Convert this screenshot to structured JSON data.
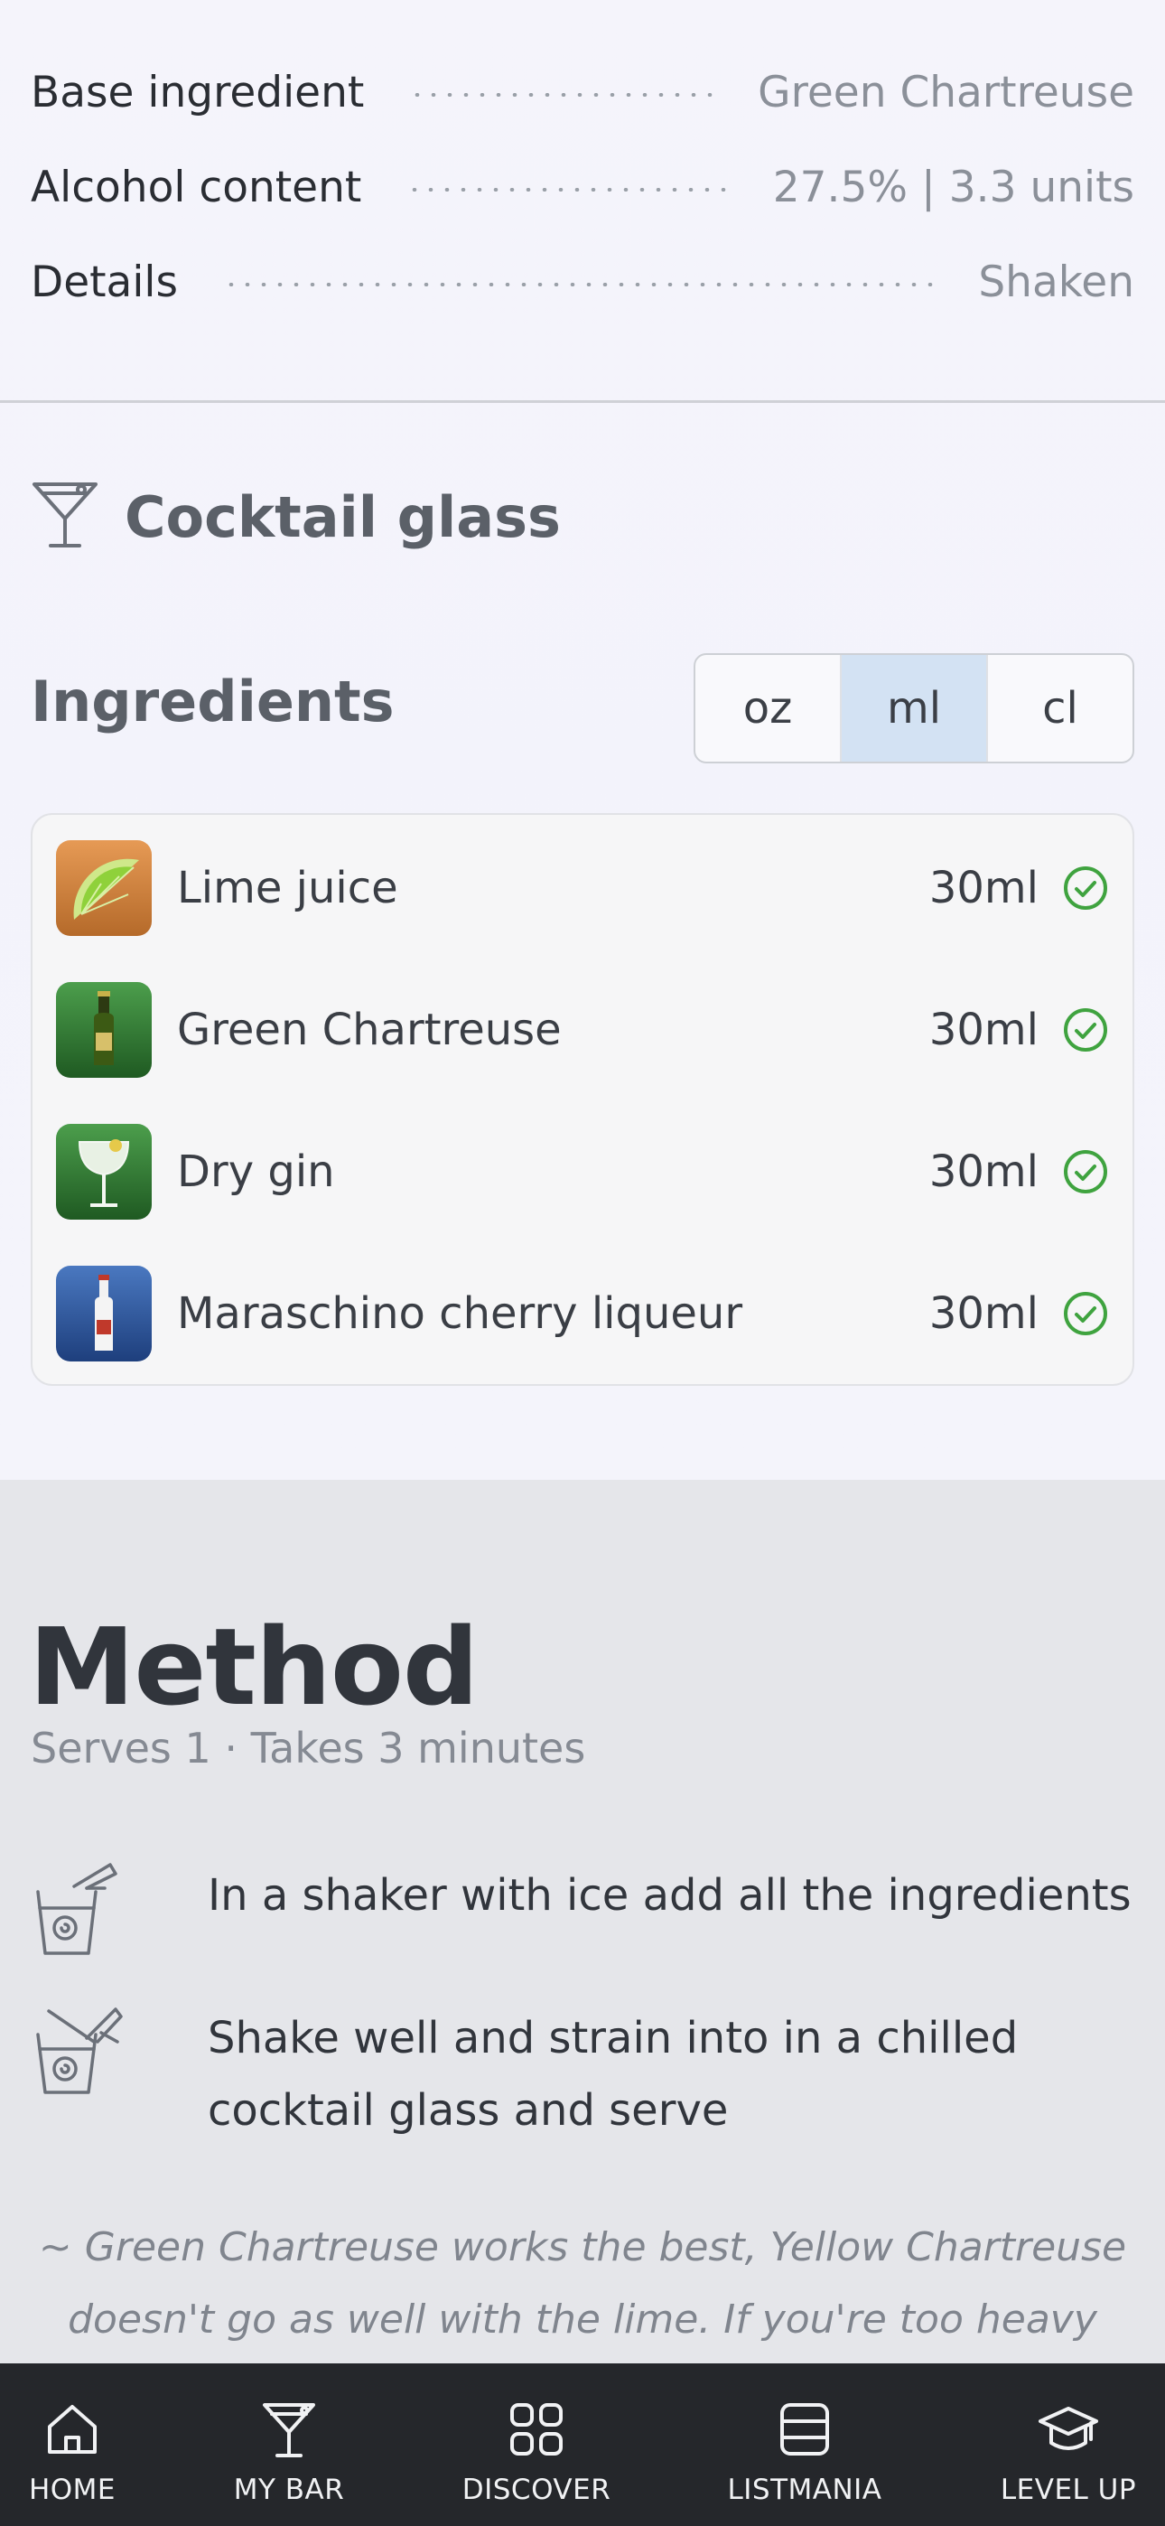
{
  "details": [
    {
      "label": "Base ingredient",
      "value": "Green Chartreuse"
    },
    {
      "label": "Alcohol content",
      "value": "27.5% | 3.3 units"
    },
    {
      "label": "Details",
      "value": "Shaken"
    }
  ],
  "glass": {
    "label": "Cocktail glass",
    "icon": "cocktail-glass-icon"
  },
  "ingredients": {
    "title": "Ingredients",
    "units": [
      {
        "label": "oz",
        "active": false
      },
      {
        "label": "ml",
        "active": true
      },
      {
        "label": "cl",
        "active": false
      }
    ],
    "items": [
      {
        "name": "Lime juice",
        "amount": "30ml",
        "icon": "lime-icon"
      },
      {
        "name": "Green Chartreuse",
        "amount": "30ml",
        "icon": "green-bottle-icon"
      },
      {
        "name": "Dry gin",
        "amount": "30ml",
        "icon": "gin-glass-icon"
      },
      {
        "name": "Maraschino cherry liqueur",
        "amount": "30ml",
        "icon": "white-bottle-icon"
      }
    ]
  },
  "method": {
    "title": "Method",
    "subtitle": "Serves 1 · Takes 3 minutes",
    "steps": [
      {
        "line1": "In a shaker with ice add all the ingredients",
        "line2": ""
      },
      {
        "line1": "Shake well and strain into in a chilled",
        "line2": "cocktail glass and serve"
      }
    ],
    "note_line1": "~ Green Chartreuse works the best, Yellow Chartreuse",
    "note_line2": "doesn't go as well with the lime. If you're too heavy with"
  },
  "nav": [
    {
      "label": "HOME",
      "icon": "home-icon"
    },
    {
      "label": "MY BAR",
      "icon": "cocktail-glass-icon"
    },
    {
      "label": "DISCOVER",
      "icon": "grid-icon"
    },
    {
      "label": "LISTMANIA",
      "icon": "list-icon"
    },
    {
      "label": "LEVEL UP",
      "icon": "graduation-cap-icon"
    }
  ],
  "colors": {
    "accent_check": "#3fa33f",
    "unit_active_bg": "#d3e2f3",
    "nav_bg": "#25272b",
    "method_bg": "#e5e6ea"
  }
}
